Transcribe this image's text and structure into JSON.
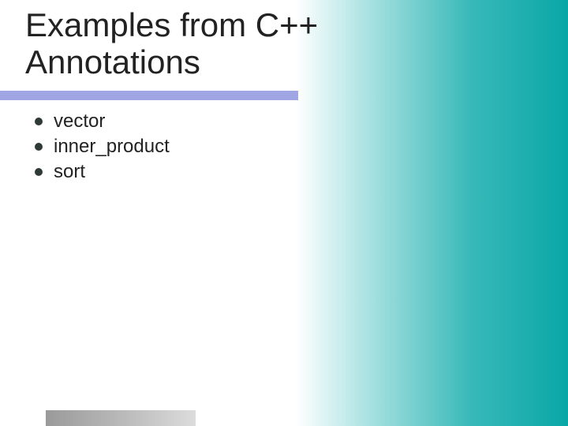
{
  "slide": {
    "title": "Examples from C++ Annotations",
    "bullets": [
      {
        "text": "vector"
      },
      {
        "text": "inner_product"
      },
      {
        "text": "sort"
      }
    ]
  }
}
